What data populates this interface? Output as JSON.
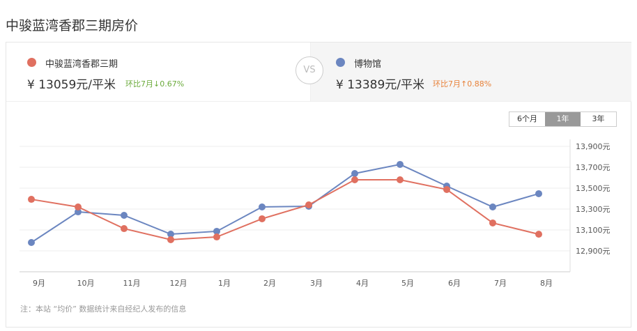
{
  "title": "中骏蓝湾香郡三期房价",
  "compare": {
    "left": {
      "name": "中骏蓝湾香郡三期",
      "price": "¥ 13059元/平米",
      "change": "环比7月↓0.67%",
      "color": "#e07060",
      "change_color": "#6aaa3a"
    },
    "vs": "VS",
    "right": {
      "name": "博物馆",
      "price": "¥ 13389元/平米",
      "change": "环比7月↑0.88%",
      "color": "#6b86c0",
      "change_color": "#e8823a"
    }
  },
  "range_buttons": [
    {
      "label": "6个月",
      "active": false
    },
    {
      "label": "1年",
      "active": true
    },
    {
      "label": "3年",
      "active": false
    }
  ],
  "note": "注：本站 “均价” 数据统计来自经纪人发布的信息",
  "chart_data": {
    "type": "line",
    "categories": [
      "9月",
      "10月",
      "11月",
      "12月",
      "1月",
      "2月",
      "3月",
      "4月",
      "5月",
      "6月",
      "7月",
      "8月"
    ],
    "y_ticks": [
      "13,900元",
      "13,700元",
      "13,500元",
      "13,300元",
      "13,100元",
      "12,900元"
    ],
    "y_tick_values": [
      13900,
      13700,
      13500,
      13300,
      13100,
      12900
    ],
    "ylim": [
      12700,
      13900
    ],
    "series": [
      {
        "name": "中骏蓝湾香郡三期",
        "color": "#e07060",
        "values": [
          13393,
          13320,
          13113,
          13007,
          13033,
          13207,
          13340,
          13580,
          13580,
          13487,
          13167,
          13059
        ]
      },
      {
        "name": "博物馆",
        "color": "#6b86c0",
        "values": [
          12980,
          13273,
          13240,
          13060,
          13087,
          13320,
          13327,
          13640,
          13727,
          13520,
          13320,
          13447
        ]
      }
    ]
  }
}
